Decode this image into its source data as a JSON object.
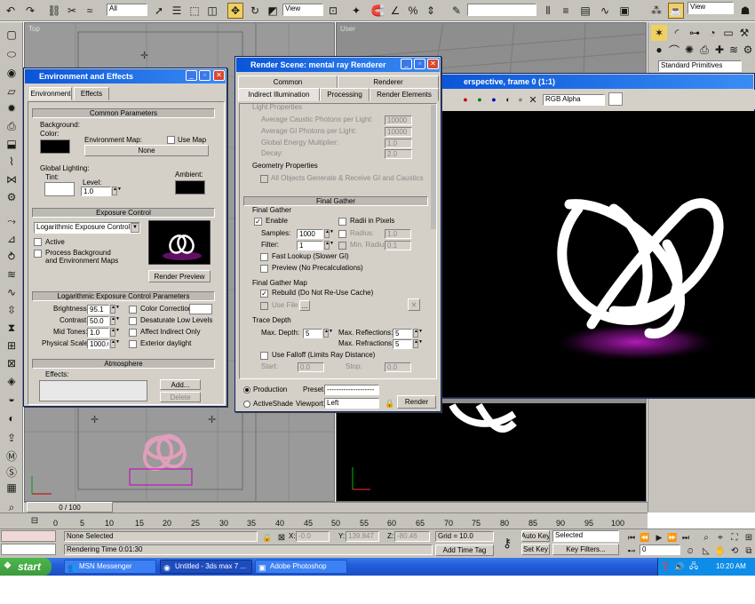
{
  "toolbar": {
    "selection_filter": "All",
    "ref_coord": "View",
    "named_sets": "",
    "right_ref": "View"
  },
  "viewports": {
    "top_label": "Top",
    "user_label": "User"
  },
  "command_panel": {
    "category": "Standard Primitives"
  },
  "env_window": {
    "title": "Environment and Effects",
    "tabs": [
      "Environment",
      "Effects"
    ],
    "common_params": "Common Parameters",
    "background": "Background:",
    "color": "Color:",
    "env_map": "Environment Map:",
    "use_map": "Use Map",
    "none": "None",
    "global_lighting": "Global Lighting:",
    "tint": "Tint:",
    "level": "Level:",
    "level_value": "1.0",
    "ambient": "Ambient:",
    "exposure_control": "Exposure Control",
    "exposure_type": "Logarithmic Exposure Control",
    "active": "Active",
    "process_bg": "Process Background",
    "process_bg2": "and Environment Maps",
    "render_preview": "Render Preview",
    "log_params": "Logarithmic Exposure Control Parameters",
    "brightness_label": "Brightness:",
    "brightness": "95.1",
    "contrast_label": "Contrast:",
    "contrast": "50.0",
    "midtones_label": "Mid Tones:",
    "midtones": "1.0",
    "physical_label": "Physical Scale:",
    "physical": "1000.0",
    "color_correction": "Color Correction:",
    "desaturate": "Desaturate Low Levels",
    "affect_indirect": "Affect Indirect Only",
    "exterior": "Exterior daylight",
    "atmosphere": "Atmosphere",
    "effects": "Effects:",
    "add": "Add...",
    "delete": "Delete"
  },
  "render_window": {
    "title": "Render Scene: mental ray Renderer",
    "tabs_top": [
      "Common",
      "Renderer"
    ],
    "tabs_bottom": [
      "Indirect Illumination",
      "Processing",
      "Render Elements"
    ],
    "light_props": "Light Properties",
    "avg_caustic": "Average Caustic Photons per Light:",
    "avg_caustic_val": "10000",
    "avg_gi": "Average GI Photons per Light:",
    "avg_gi_val": "10000",
    "energy": "Global Energy Multiplier:",
    "energy_val": "1.0",
    "decay": "Decay:",
    "decay_val": "2.0",
    "geom_props": "Geometry Properties",
    "all_objects": "All Objects Generate & Receive GI and Caustics",
    "final_gather_roll": "Final Gather",
    "final_gather_grp": "Final Gather",
    "enable": "Enable",
    "radii_pixels": "Radii in Pixels",
    "samples": "Samples:",
    "samples_val": "1000",
    "radius": "Radius:",
    "radius_val": "1.0",
    "filter": "Filter:",
    "filter_val": "1",
    "min_radius": "Min. Radius:",
    "min_radius_val": "0.1",
    "fast_lookup": "Fast Lookup (Slower GI)",
    "preview": "Preview (No Precalculations)",
    "fg_map": "Final Gather Map",
    "rebuild": "Rebuild (Do Not Re-Use Cache)",
    "use_file": "Use File",
    "trace_depth": "Trace Depth",
    "max_depth": "Max. Depth:",
    "max_depth_val": "5",
    "max_refl": "Max. Reflections:",
    "max_refl_val": "5",
    "max_refr": "Max. Refractions:",
    "max_refr_val": "5",
    "use_falloff": "Use Falloff (Limits Ray Distance)",
    "start": "Start:",
    "start_val": "0.0",
    "stop": "Stop:",
    "stop_val": "0.0",
    "production": "Production",
    "preset": "Preset:",
    "preset_val": "--------------------",
    "activeshade": "ActiveShade",
    "viewport": "Viewport:",
    "viewport_val": "Left",
    "render": "Render"
  },
  "frame_window": {
    "title": "erspective, frame 0 (1:1)",
    "channel": "RGB Alpha"
  },
  "timeline": {
    "slider": "0 / 100",
    "ticks": [
      "0",
      "5",
      "10",
      "15",
      "20",
      "25",
      "30",
      "35",
      "40",
      "45",
      "50",
      "55",
      "60",
      "65",
      "70",
      "75",
      "80",
      "85",
      "90",
      "95",
      "100"
    ]
  },
  "status": {
    "selection": "None Selected",
    "render_time": "Rendering Time  0:01:30",
    "x_label": "X:",
    "x_val": "-0.0",
    "y_label": "Y:",
    "y_val": "139.847",
    "z_label": "Z:",
    "z_val": "-80.46",
    "grid": "Grid = 10.0",
    "add_time_tag": "Add Time Tag",
    "auto_key": "Auto Key",
    "set_key": "Set Key",
    "selected": "Selected",
    "key_filters": "Key Filters...",
    "frame": "0"
  },
  "taskbar": {
    "start": "start",
    "items": [
      "MSN Messenger",
      "Untitled - 3ds max 7 ...",
      "Adobe Photoshop"
    ],
    "clock": "10:20 AM"
  },
  "colors": {
    "title_blue": "#0a55d8",
    "render_bg": "#000000",
    "glow": "#c71fd1",
    "taskbar": "#245edb",
    "start": "#3c9a3c"
  }
}
